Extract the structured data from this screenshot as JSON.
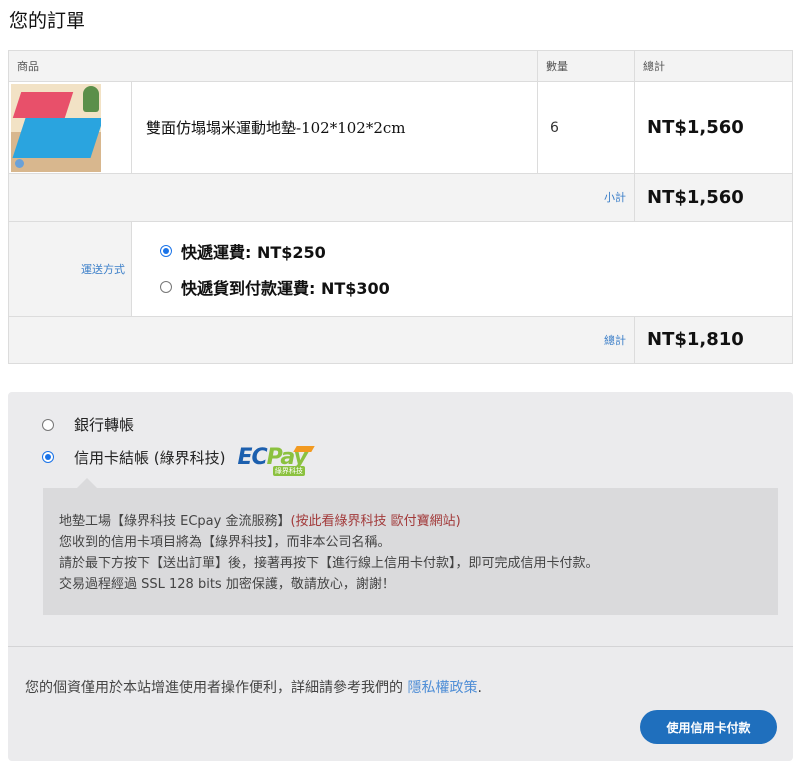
{
  "page": {
    "title": "您的訂單"
  },
  "table": {
    "headers": {
      "product": "商品",
      "quantity": "數量",
      "total": "總計"
    },
    "item": {
      "name": "雙面仿塌塌米運動地墊-102*102*2cm",
      "quantity": "6",
      "price": "NT$1,560"
    },
    "subtotal": {
      "label": "小計",
      "value": "NT$1,560"
    },
    "shipping": {
      "label": "運送方式",
      "options": [
        {
          "label": "快遞運費: NT$250",
          "selected": true
        },
        {
          "label": "快遞貨到付款運費: NT$300",
          "selected": false
        }
      ]
    },
    "total": {
      "label": "總計",
      "value": "NT$1,810"
    }
  },
  "payment": {
    "options": [
      {
        "label": "銀行轉帳",
        "selected": false
      },
      {
        "label": "信用卡結帳 (綠界科技)",
        "selected": true
      }
    ],
    "logo": {
      "ec": "EC",
      "pay": "Pay",
      "sub": "綠界科技"
    },
    "info": {
      "line1_prefix": "地墊工場【綠界科技 ECpay 金流服務】",
      "line1_link": "(按此看綠界科技 歐付寶網站)",
      "line2": "您收到的信用卡項目將為【綠界科技】，而非本公司名稱。",
      "line3": "請於最下方按下【送出訂單】後，接著再按下【進行線上信用卡付款】，即可完成信用卡付款。",
      "line4": "交易過程經過 SSL 128 bits 加密保護，敬請放心，謝謝！"
    },
    "privacy_text": "您的個資僅用於本站增進使用者操作便利，詳細請參考我們的 ",
    "privacy_link": "隱私權政策",
    "privacy_end": ".",
    "submit_label": "使用信用卡付款"
  },
  "colors": {
    "accent": "#1f6fbd",
    "link": "#3a7ec8",
    "panel": "#ebebed"
  }
}
